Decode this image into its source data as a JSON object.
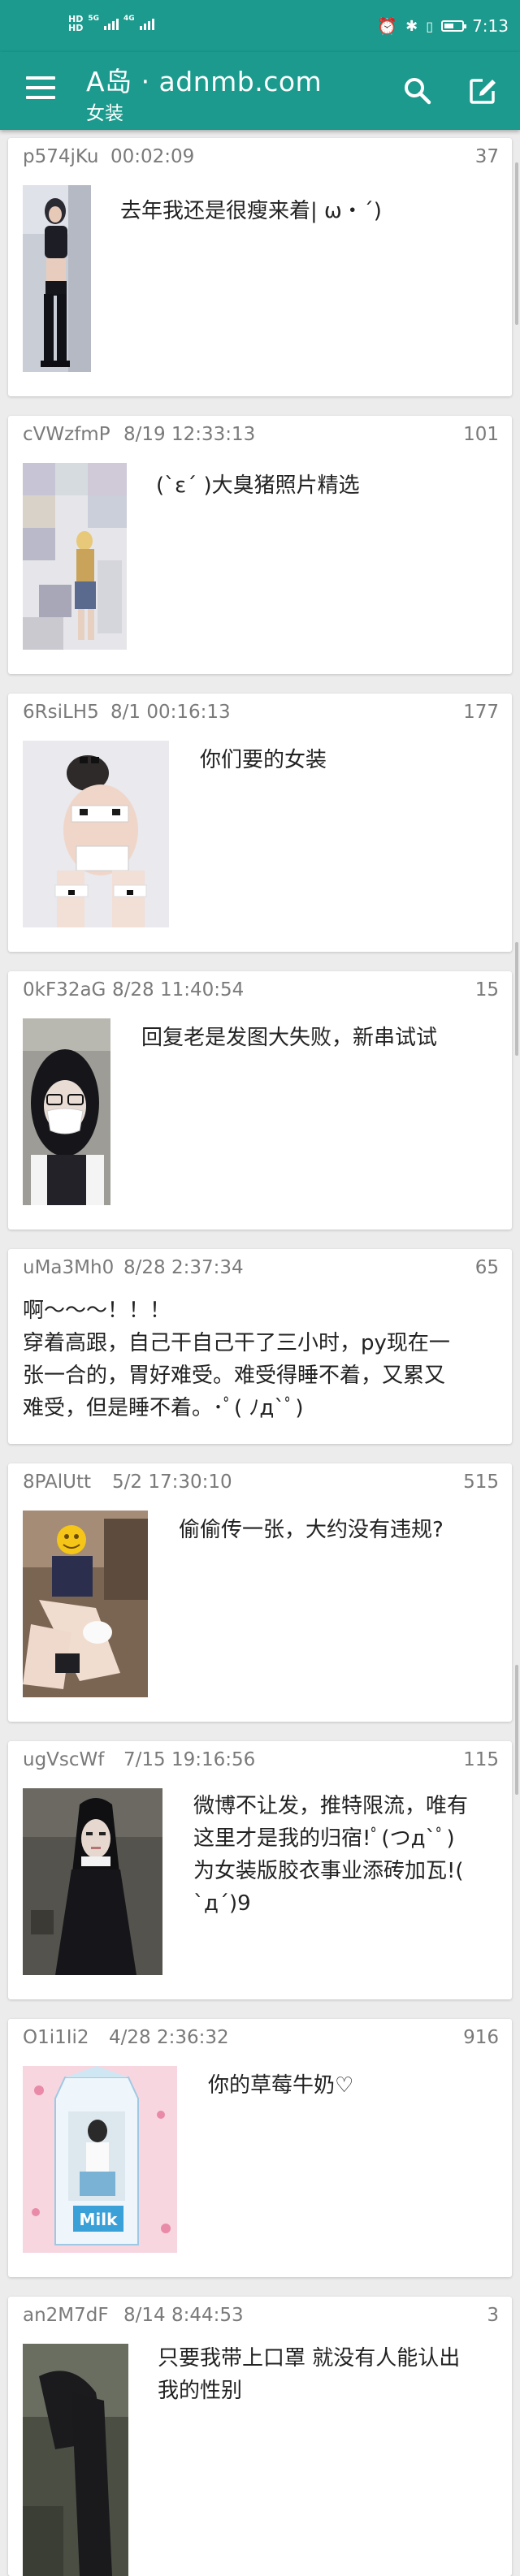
{
  "status": {
    "network_left": "HD",
    "network_right": "HD",
    "sig1": "5G",
    "sig2": "4G",
    "time": "7:13",
    "battery_level": 0.45
  },
  "header": {
    "title": "A岛 · adnmb.com",
    "subtitle": "女装",
    "menu_icon": "menu-icon",
    "search_icon": "search-icon",
    "edit_icon": "edit-icon"
  },
  "threads": [
    {
      "uid": "p574jKu",
      "time": "00:02:09",
      "count": "37",
      "text": "去年我还是很瘦来着| ω・´)"
    },
    {
      "uid": "cVWzfmP",
      "time": "8/19 12:33:13",
      "count": "101",
      "text": "(`ε´ )大臭猪照片精选"
    },
    {
      "uid": "6RsiLH5",
      "time": "8/1 00:16:13",
      "count": "177",
      "text": "你们要的女装"
    },
    {
      "uid": "0kF32aG",
      "time": "8/28 11:40:54",
      "count": "15",
      "text": "回复老是发图大失败，新串试试"
    },
    {
      "uid": "uMa3Mh0",
      "time": "8/28 2:37:34",
      "count": "65",
      "text": "啊～～～！！！"
    },
    {
      "uid": "8PAlUtt",
      "time": "5/2 17:30:10",
      "count": "515",
      "text": "偷偷传一张，大约没有违规?"
    },
    {
      "uid": "ugVscWf",
      "time": "7/15 19:16:56",
      "count": "115",
      "text": "微博不让发，推特限流，唯有"
    },
    {
      "uid": "O1i1Ii2",
      "time": "4/28 2:36:32",
      "count": "916",
      "text": "你的草莓牛奶♡"
    },
    {
      "uid": "an2M7dF",
      "time": "8/14 8:44:53",
      "count": "3",
      "text": "只要我带上口罩 就没有人能认出"
    }
  ],
  "thread5_extra": {
    "line2": "穿着高跟，自己干自己干了三小时，py现在一",
    "line3": "张一合的，胃好难受。难受得睡不着，又累又",
    "line4": "难受，但是睡不着。･ﾟ( ﾉд`ﾟ)"
  },
  "thread7_extra": {
    "line2": "这里才是我的归宿!ﾟ(つд`ﾟ)",
    "line3": "为女装版胶衣事业添砖加瓦!(",
    "line4": "`д´)9"
  },
  "thread9_extra": {
    "line2": "我的性别"
  },
  "milk_label": "Milk"
}
